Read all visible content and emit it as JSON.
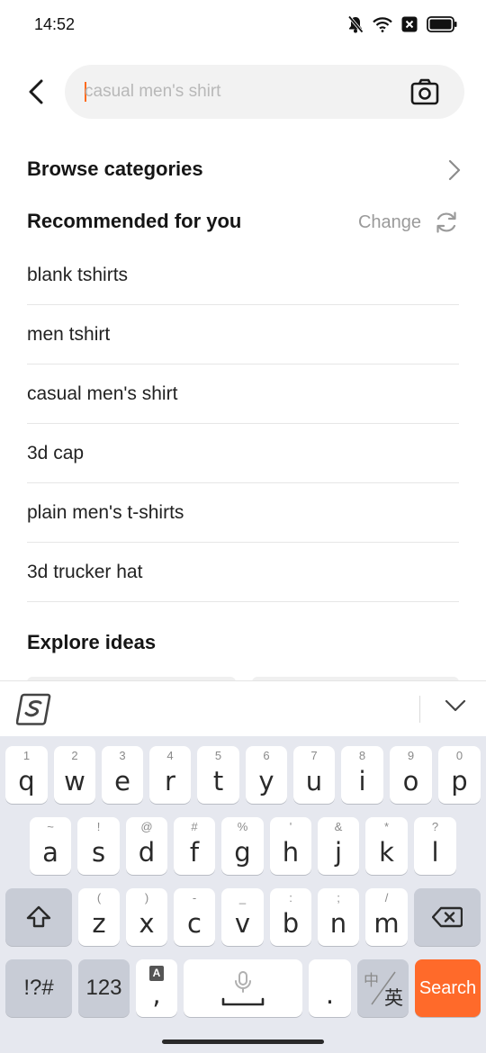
{
  "status_bar": {
    "time": "14:52",
    "icons": [
      "bell-off-icon",
      "wifi-icon",
      "sim-blocked-icon",
      "battery-icon"
    ]
  },
  "search": {
    "placeholder": "casual men's shirt",
    "value": "",
    "back_icon": "back-arrow-icon",
    "camera_icon": "camera-icon"
  },
  "browse": {
    "title": "Browse categories"
  },
  "recommended": {
    "title": "Recommended for you",
    "change_label": "Change",
    "items": [
      {
        "label": "blank tshirts"
      },
      {
        "label": "men tshirt"
      },
      {
        "label": "casual men's shirt"
      },
      {
        "label": "3d cap"
      },
      {
        "label": "plain men's t-shirts"
      },
      {
        "label": "3d trucker hat"
      }
    ]
  },
  "explore": {
    "title": "Explore ideas"
  },
  "keyboard": {
    "row1": [
      {
        "key": "q",
        "sub": "1"
      },
      {
        "key": "w",
        "sub": "2"
      },
      {
        "key": "e",
        "sub": "3"
      },
      {
        "key": "r",
        "sub": "4"
      },
      {
        "key": "t",
        "sub": "5"
      },
      {
        "key": "y",
        "sub": "6"
      },
      {
        "key": "u",
        "sub": "7"
      },
      {
        "key": "i",
        "sub": "8"
      },
      {
        "key": "o",
        "sub": "9"
      },
      {
        "key": "p",
        "sub": "0"
      }
    ],
    "row2": [
      {
        "key": "a",
        "sub": "~"
      },
      {
        "key": "s",
        "sub": "!"
      },
      {
        "key": "d",
        "sub": "@"
      },
      {
        "key": "f",
        "sub": "#"
      },
      {
        "key": "g",
        "sub": "%"
      },
      {
        "key": "h",
        "sub": "'"
      },
      {
        "key": "j",
        "sub": "&"
      },
      {
        "key": "k",
        "sub": "*"
      },
      {
        "key": "l",
        "sub": "?"
      }
    ],
    "row3": [
      {
        "key": "z",
        "sub": "("
      },
      {
        "key": "x",
        "sub": ")"
      },
      {
        "key": "c",
        "sub": "-"
      },
      {
        "key": "v",
        "sub": "_"
      },
      {
        "key": "b",
        "sub": ":"
      },
      {
        "key": "n",
        "sub": ";"
      },
      {
        "key": "m",
        "sub": "/"
      }
    ],
    "symbols_label": "!?#",
    "numbers_label": "123",
    "comma_label": ",",
    "comma_sub": "A",
    "period_label": ".",
    "lang_top": "中",
    "lang_bottom": "英",
    "search_label": "Search",
    "accent_color": "#ff6a2a"
  }
}
